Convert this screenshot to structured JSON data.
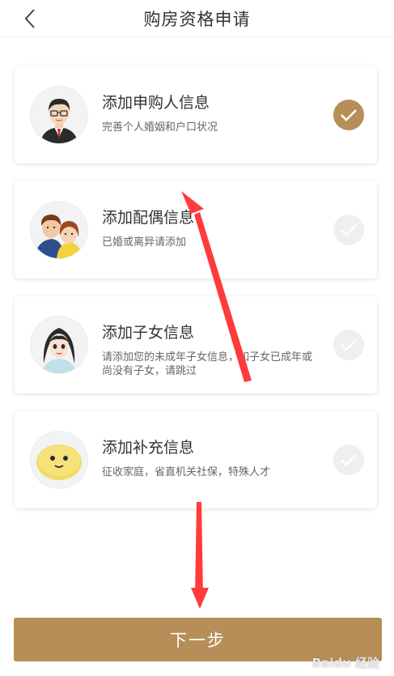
{
  "header": {
    "title": "购房资格申请",
    "back_icon": "chevron-left-icon"
  },
  "cards": [
    {
      "title": "添加申购人信息",
      "desc": "完善个人婚姻和户口状况",
      "checked": true,
      "avatar_icon": "man-avatar-icon"
    },
    {
      "title": "添加配偶信息",
      "desc": "已婚或离异请添加",
      "checked": false,
      "avatar_icon": "couple-avatar-icon"
    },
    {
      "title": "添加子女信息",
      "desc": "请添加您的未成年子女信息，如子女已成年或尚没有子女，请跳过",
      "checked": false,
      "avatar_icon": "girl-avatar-icon"
    },
    {
      "title": "添加补充信息",
      "desc": "征收家庭，省直机关社保，特殊人才",
      "checked": false,
      "avatar_icon": "smiley-avatar-icon"
    }
  ],
  "footer": {
    "next_label": "下一步"
  },
  "watermark": {
    "text": "Baidu 经验"
  },
  "colors": {
    "accent": "#b78e57",
    "arrow": "#ff3b3b",
    "check_off": "#efefef"
  }
}
